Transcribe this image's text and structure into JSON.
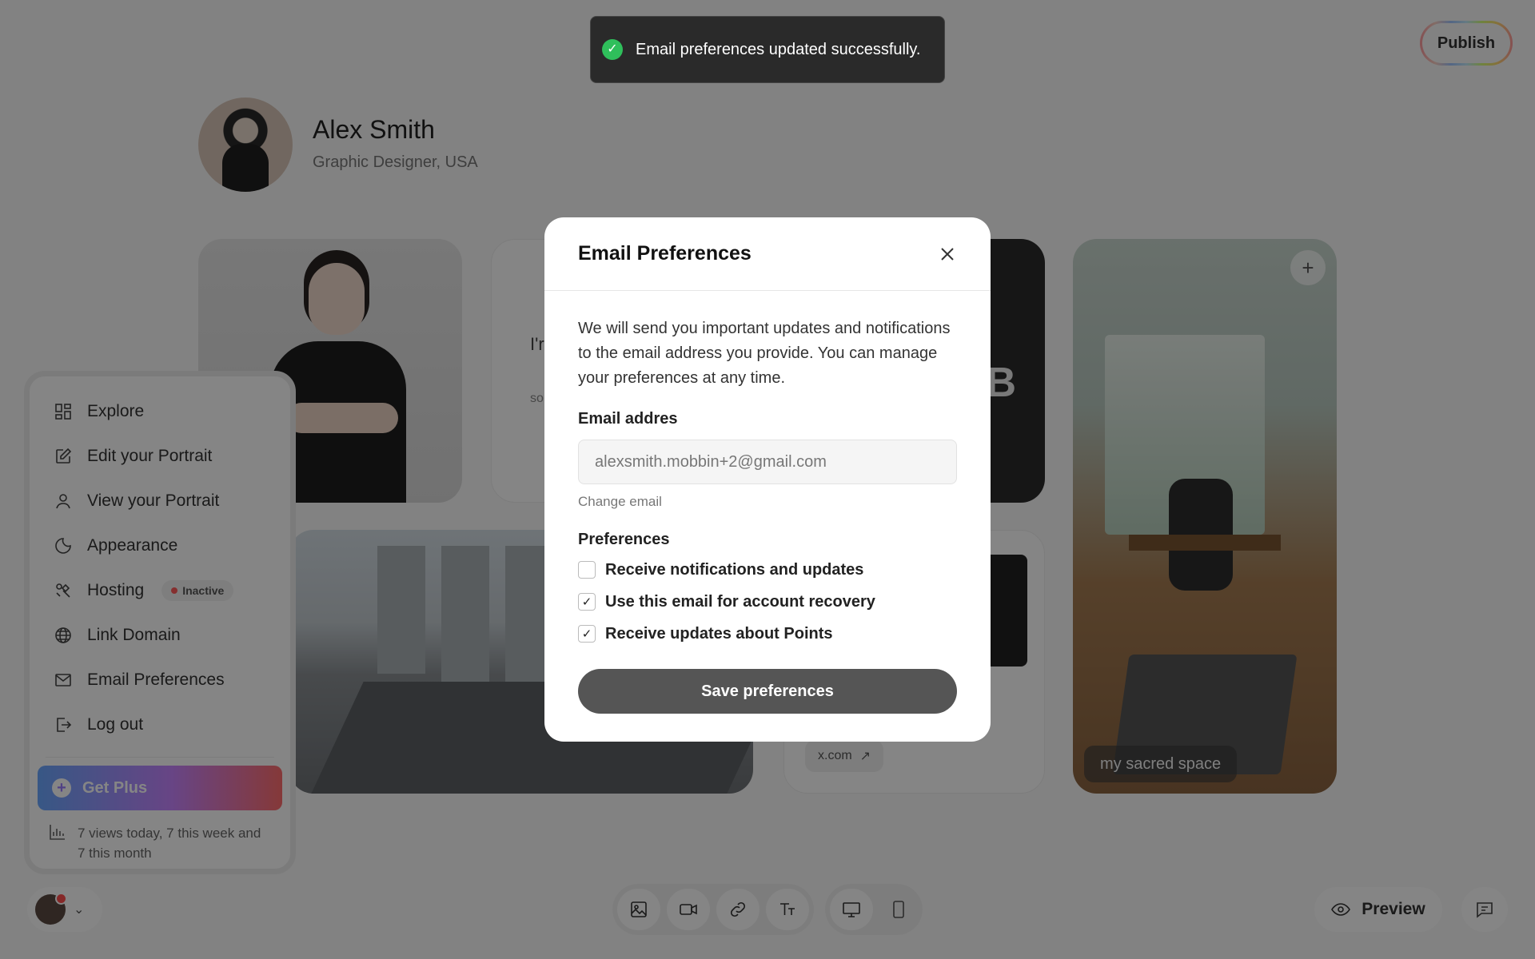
{
  "header": {
    "publish_label": "Publish"
  },
  "profile": {
    "name": "Alex Smith",
    "role": "Graphic Designer, USA"
  },
  "cards": {
    "text_snippet_1": "I'r",
    "text_snippet_2": "so",
    "dark_letter": "B",
    "room_caption": "my sacred space",
    "social_link": "x.com"
  },
  "sidebar": {
    "items": [
      {
        "label": "Explore",
        "icon": "grid-icon"
      },
      {
        "label": "Edit your Portrait",
        "icon": "edit-icon"
      },
      {
        "label": "View your Portrait",
        "icon": "user-icon"
      },
      {
        "label": "Appearance",
        "icon": "moon-icon"
      },
      {
        "label": "Hosting",
        "icon": "hosting-icon",
        "badge": "Inactive"
      },
      {
        "label": "Link Domain",
        "icon": "globe-icon"
      },
      {
        "label": "Email Preferences",
        "icon": "mail-icon"
      },
      {
        "label": "Log out",
        "icon": "logout-icon"
      }
    ],
    "get_plus": "Get Plus",
    "stats": "7 views today, 7 this week and 7 this month"
  },
  "bottom": {
    "preview_label": "Preview"
  },
  "toast": {
    "message": "Email preferences updated successfully."
  },
  "modal": {
    "title": "Email Preferences",
    "description": "We will send you important updates and notifications to the email address you provide. You can manage your preferences at any time.",
    "email_label": "Email addres",
    "email_value": "alexsmith.mobbin+2@gmail.com",
    "change_email": "Change email",
    "preferences_label": "Preferences",
    "preferences": [
      {
        "label": "Receive notifications and updates",
        "checked": false
      },
      {
        "label": "Use this email for account recovery",
        "checked": true
      },
      {
        "label": "Receive updates about Points",
        "checked": true
      }
    ],
    "save_label": "Save preferences"
  },
  "colors": {
    "toast_success": "#2fbf5b",
    "overlay": "rgba(0,0,0,0.48)",
    "save_button": "#555555"
  }
}
